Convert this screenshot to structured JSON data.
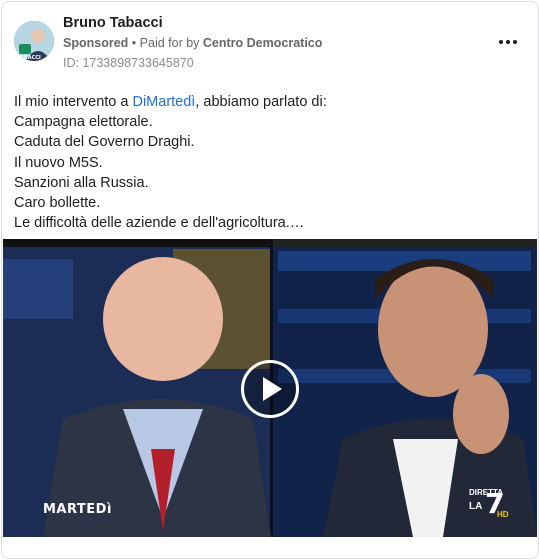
{
  "post": {
    "author": "Bruno Tabacci",
    "sponsored": "Sponsored",
    "separator": "•",
    "paid_for_prefix": "Paid for by",
    "paid_for_by": "Centro Democratico",
    "ad_id": "ID: 1733898733645870",
    "text_intro_prefix": "Il mio intervento a ",
    "text_intro_link": "DiMartedì",
    "text_intro_suffix": ", abbiamo parlato di:",
    "lines": [
      "Campagna elettorale.",
      "Caduta del Governo Draghi.",
      "Il nuovo M5S.",
      "Sanzioni alla Russia.",
      "Caro bollette.",
      "Le difficoltà delle aziende e dell'agricoltura.…"
    ]
  },
  "video": {
    "logo_left": "MARTEDì",
    "logo_right_top": "DIRETTA",
    "logo_right_la": "LA",
    "logo_right_num": "7",
    "logo_right_hd": "HD",
    "avatar_badge": "TABACCI"
  },
  "icons": {
    "more": "more-options-icon",
    "play": "play-icon"
  },
  "colors": {
    "link": "#216fdb",
    "secondary_text": "#65676b",
    "border": "#dddfe2"
  }
}
